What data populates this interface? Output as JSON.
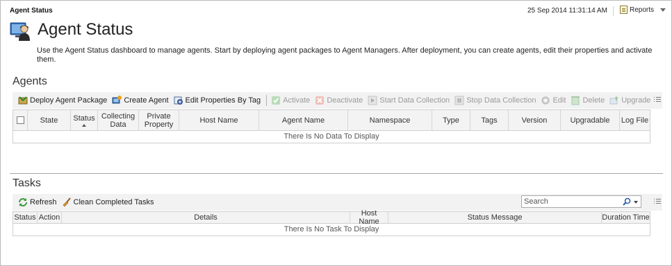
{
  "header": {
    "breadcrumb": "Agent Status",
    "timestamp": "25 Sep 2014 11:31:14 AM",
    "reports_label": "Reports"
  },
  "page": {
    "title": "Agent Status",
    "description": "Use the Agent Status dashboard to manage agents. Start by deploying agent packages to Agent Managers. After deployment, you can create agents, edit their properties and activate them."
  },
  "agents": {
    "section_title": "Agents",
    "toolbar": [
      {
        "label": "Deploy Agent Package",
        "icon": "deploy-package-icon",
        "enabled": true
      },
      {
        "label": "Create Agent",
        "icon": "create-agent-icon",
        "enabled": true
      },
      {
        "label": "Edit Properties By Tag",
        "icon": "edit-properties-icon",
        "enabled": true
      },
      {
        "label": "Activate",
        "icon": "activate-icon",
        "enabled": false
      },
      {
        "label": "Deactivate",
        "icon": "deactivate-icon",
        "enabled": false
      },
      {
        "label": "Start Data Collection",
        "icon": "start-collection-icon",
        "enabled": false
      },
      {
        "label": "Stop Data Collection",
        "icon": "stop-collection-icon",
        "enabled": false
      },
      {
        "label": "Edit",
        "icon": "edit-icon",
        "enabled": false
      },
      {
        "label": "Delete",
        "icon": "delete-icon",
        "enabled": false
      },
      {
        "label": "Upgrade",
        "icon": "upgrade-icon",
        "enabled": false
      }
    ],
    "columns": [
      "",
      "State",
      "Status",
      "Collecting Data",
      "Private Property",
      "Host Name",
      "Agent Name",
      "Namespace",
      "Type",
      "Tags",
      "Version",
      "Upgradable",
      "Log File"
    ],
    "empty_message": "There Is No Data To Display"
  },
  "tasks": {
    "section_title": "Tasks",
    "toolbar": {
      "refresh_label": "Refresh",
      "clean_label": "Clean Completed Tasks"
    },
    "search_placeholder": "Search",
    "columns": [
      "Status",
      "Action",
      "Details",
      "Host Name",
      "Status Message",
      "Duration Time"
    ],
    "empty_message": "There Is No Task To Display"
  },
  "colors": {
    "accent_green": "#3a9a3a",
    "header_bg": "#f3f3f3",
    "disabled_text": "#9a9a9a"
  }
}
